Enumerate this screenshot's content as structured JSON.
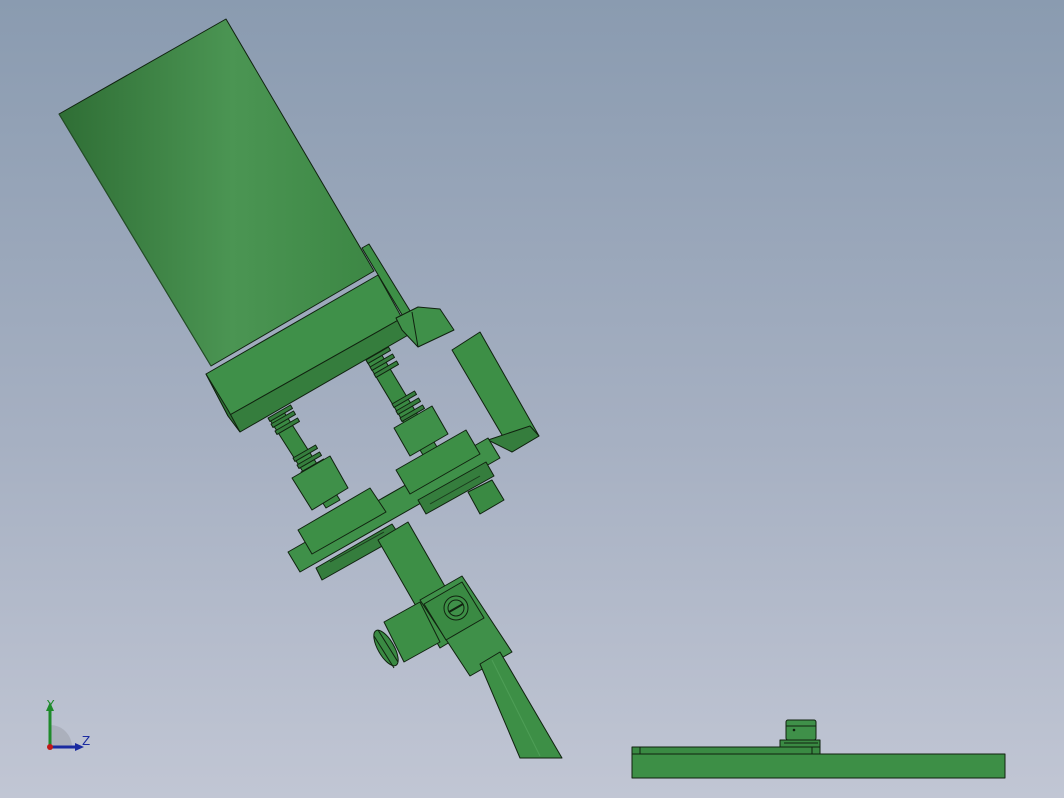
{
  "viewport": {
    "background_top": "#8a9bb0",
    "background_bottom": "#c1c6d4"
  },
  "model": {
    "part_color": "#3d8f46",
    "part_dark": "#2f7136",
    "part_light": "#4c9a55",
    "edge_color": "#10220f"
  },
  "triad": {
    "y_label": "Y",
    "z_label": "Z",
    "y_color": "#1e8a2a",
    "z_color": "#1a2aa0",
    "x_color": "#c01818",
    "icons": [
      "y-axis-arrow-icon",
      "z-axis-arrow-icon",
      "origin-dot-icon"
    ]
  }
}
